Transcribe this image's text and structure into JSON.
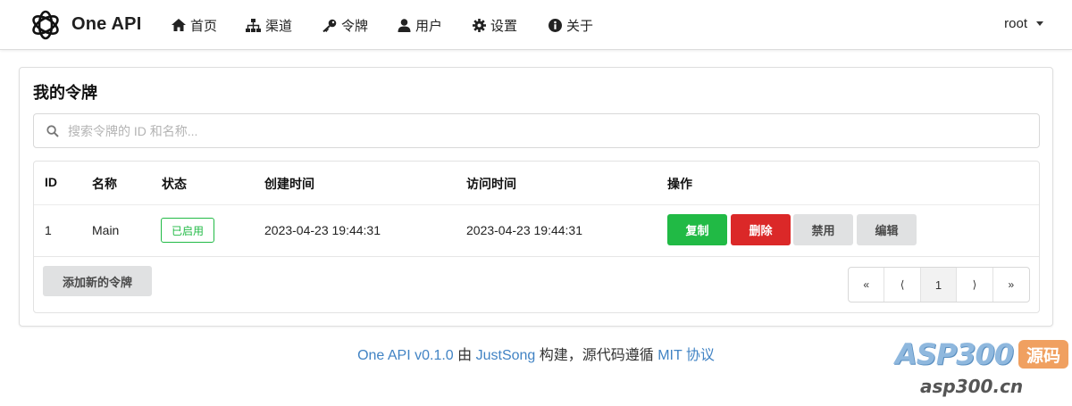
{
  "app": {
    "name": "One API"
  },
  "nav": [
    {
      "label": "首页",
      "icon": "home-icon"
    },
    {
      "label": "渠道",
      "icon": "sitemap-icon"
    },
    {
      "label": "令牌",
      "icon": "key-icon"
    },
    {
      "label": "用户",
      "icon": "user-icon"
    },
    {
      "label": "设置",
      "icon": "gear-icon"
    },
    {
      "label": "关于",
      "icon": "info-icon"
    }
  ],
  "user": {
    "name": "root"
  },
  "page": {
    "title": "我的令牌",
    "search_placeholder": "搜索令牌的 ID 和名称..."
  },
  "table": {
    "headers": [
      "ID",
      "名称",
      "状态",
      "创建时间",
      "访问时间",
      "操作"
    ],
    "rows": [
      {
        "id": "1",
        "name": "Main",
        "status": "已启用",
        "created": "2023-04-23 19:44:31",
        "accessed": "2023-04-23 19:44:31"
      }
    ],
    "actions": {
      "copy": "复制",
      "delete": "删除",
      "disable": "禁用",
      "edit": "编辑"
    }
  },
  "add_button": "添加新的令牌",
  "pagination": {
    "first": "«",
    "prev": "⟨",
    "current": "1",
    "next": "⟩",
    "last": "»"
  },
  "footer": {
    "version_link": "One API v0.1.0",
    "by": " 由 ",
    "author_link": "JustSong",
    "built": " 构建，源代码遵循 ",
    "license_link": "MIT 协议"
  },
  "watermark": {
    "brand": "ASP300",
    "badge": "源码",
    "domain": "asp300.cn"
  },
  "colors": {
    "green": "#21ba45",
    "red": "#db2828",
    "grey": "#e0e1e2",
    "link": "#4183c4"
  }
}
